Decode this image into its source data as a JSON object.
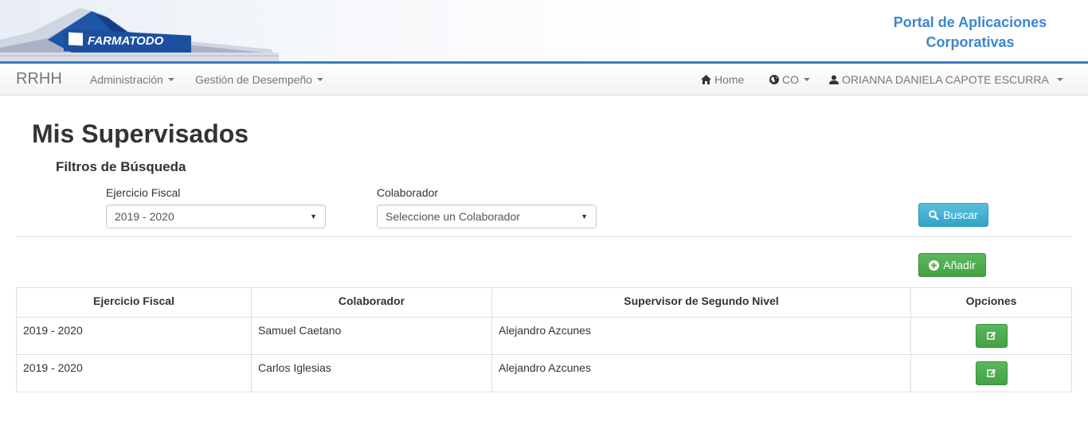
{
  "banner": {
    "logo_text": "FARMATODO",
    "portal_title_line1": "Portal de Aplicaciones",
    "portal_title_line2": "Corporativas"
  },
  "navbar": {
    "brand": "RRHH",
    "menu_admin": "Administración",
    "menu_performance": "Gestión de Desempeño",
    "home": "Home",
    "country": "CO",
    "user": "ORIANNA DANIELA CAPOTE ESCURRA"
  },
  "page": {
    "title": "Mis Supervisados",
    "filters_title": "Filtros de Búsqueda"
  },
  "filters": {
    "fiscal_label": "Ejercicio Fiscal",
    "fiscal_value": "2019 - 2020",
    "collab_label": "Colaborador",
    "collab_placeholder": "Seleccione un Colaborador",
    "search_button": "Buscar"
  },
  "actions": {
    "add_button": "Añadir"
  },
  "table": {
    "headers": [
      "Ejercicio Fiscal",
      "Colaborador",
      "Supervisor de Segundo Nivel",
      "Opciones"
    ],
    "rows": [
      {
        "fiscal": "2019 - 2020",
        "collaborator": "Samuel Caetano",
        "supervisor": "Alejandro Azcunes"
      },
      {
        "fiscal": "2019 - 2020",
        "collaborator": "Carlos Iglesias",
        "supervisor": "Alejandro Azcunes"
      }
    ]
  },
  "colors": {
    "accent_blue": "#3a86d0",
    "info": "#5bc0de",
    "success": "#5cb85c"
  },
  "icons": [
    "home-icon",
    "globe-icon",
    "user-icon",
    "search-icon",
    "plus-circle-icon",
    "edit-icon"
  ]
}
